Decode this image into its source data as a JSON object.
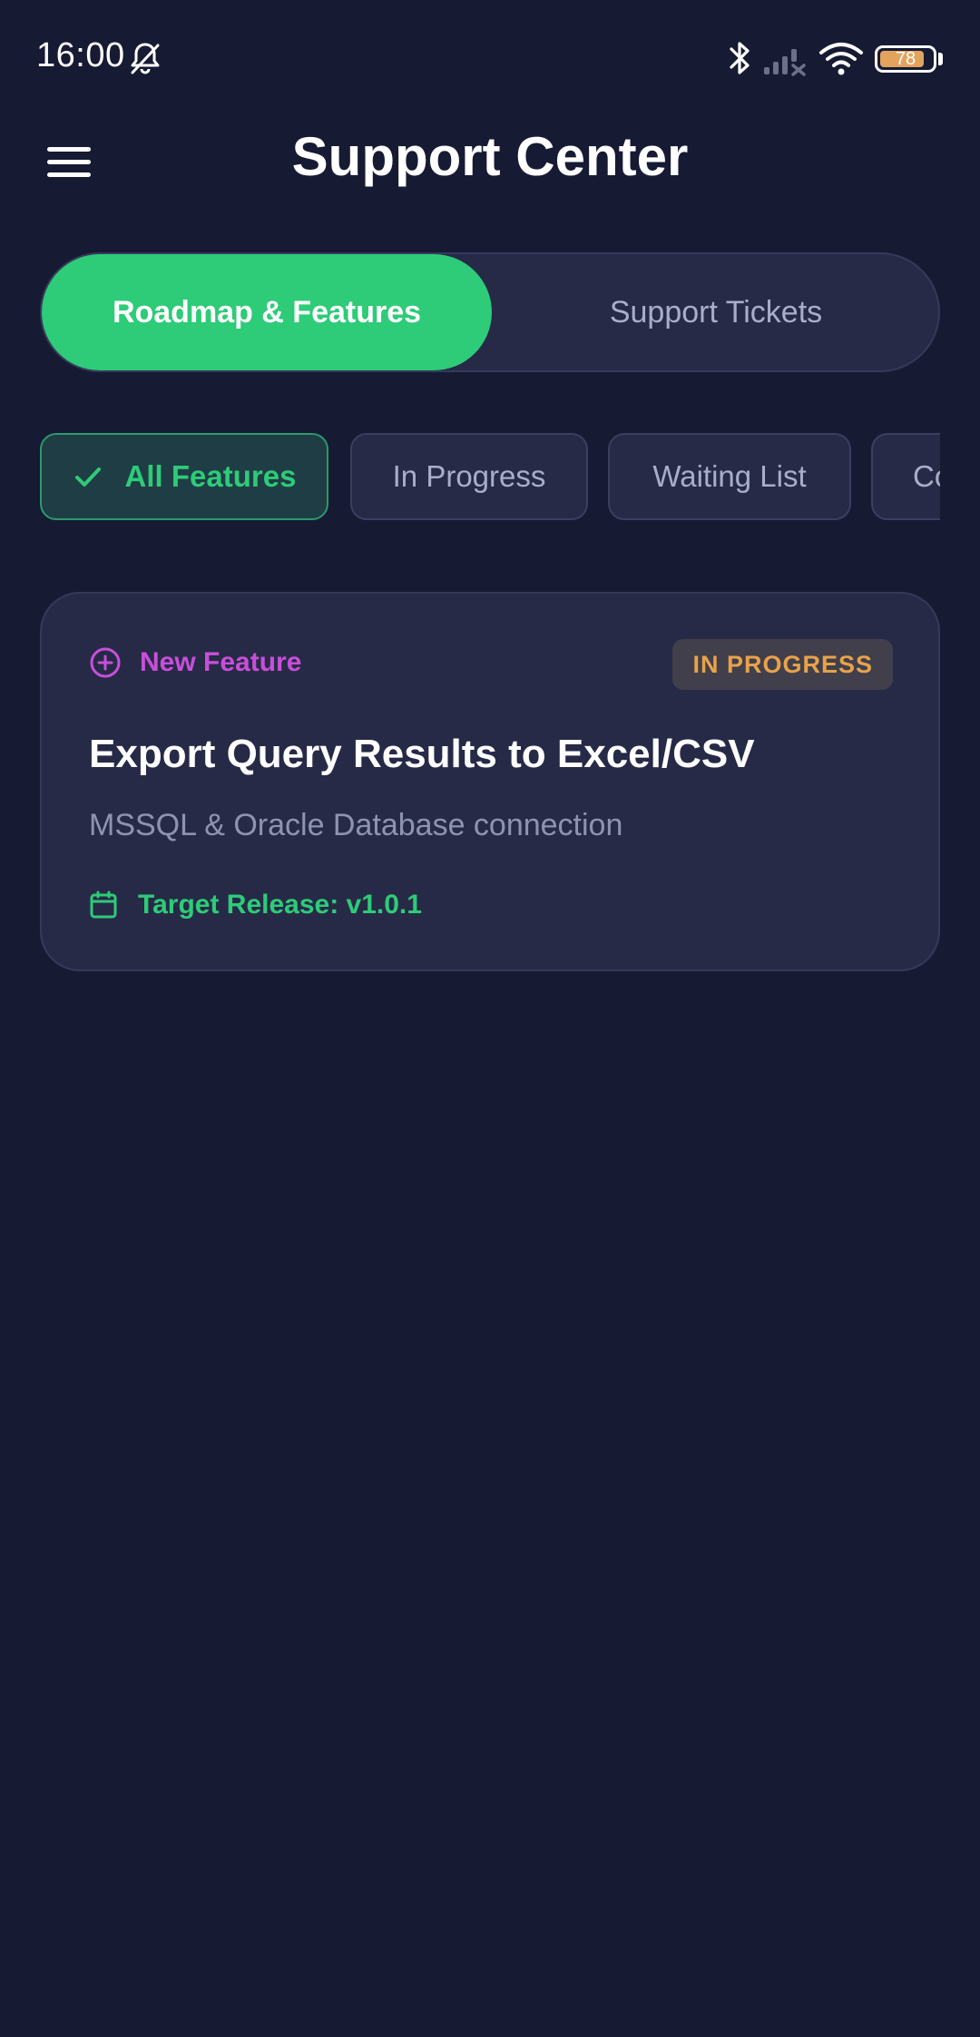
{
  "status_bar": {
    "time": "16:00",
    "battery_level": "78",
    "icons": [
      "bell-off-icon",
      "bluetooth-icon",
      "signal-icon",
      "wifi-icon",
      "battery-icon"
    ]
  },
  "header": {
    "title": "Support Center",
    "menu_icon": "menu-icon"
  },
  "segmented": {
    "active": "Roadmap & Features",
    "inactive": "Support Tickets"
  },
  "filters": {
    "selected": "All Features",
    "items": [
      "All Features",
      "In Progress",
      "Waiting List",
      "Co"
    ]
  },
  "feature_card": {
    "type_label": "New Feature",
    "status": "IN PROGRESS",
    "title": "Export Query Results to Excel/CSV",
    "description": "MSSQL & Oracle Database connection",
    "release": "Target Release: v1.0.1"
  },
  "colors": {
    "background": "#161a33",
    "surface": "#262a47",
    "accent_green": "#2ecb78",
    "feature_purple": "#c84fd9",
    "status_orange": "#e8a24a"
  }
}
